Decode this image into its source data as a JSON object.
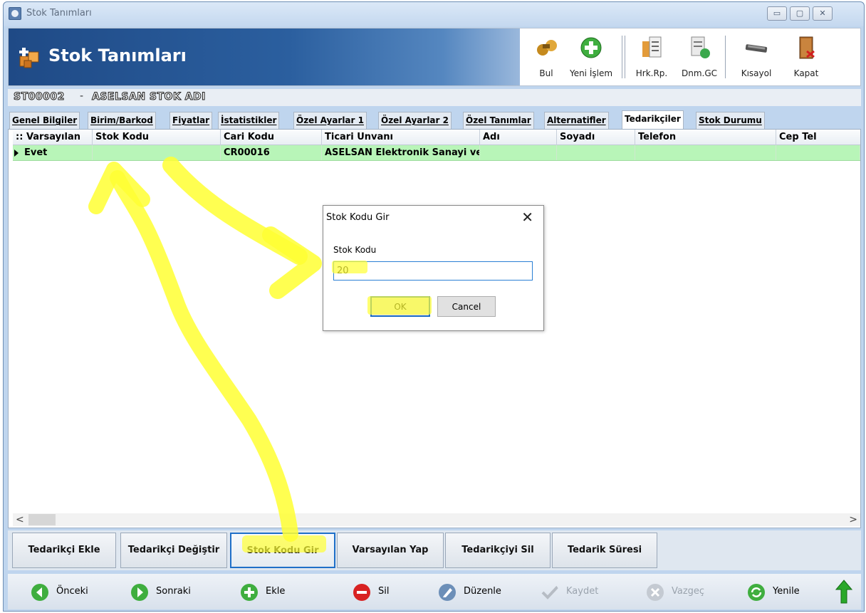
{
  "window": {
    "title": "Stok Tanımları",
    "controls": [
      "▭",
      "▢",
      "✕"
    ]
  },
  "header": {
    "title": "Stok Tanımları",
    "toolbar": [
      {
        "label": "Bul",
        "icon": "search-binoculars-icon"
      },
      {
        "label": "Yeni İşlem",
        "icon": "plus-circle-icon"
      },
      {
        "label": "Hrk.Rp.",
        "icon": "report-icon"
      },
      {
        "label": "Dnm.GC",
        "icon": "period-document-icon"
      },
      {
        "label": "Kısayol",
        "icon": "shortcut-icon"
      },
      {
        "label": "Kapat",
        "icon": "exit-door-icon"
      }
    ]
  },
  "record": {
    "code": "ST00002",
    "separator": "-",
    "name": "ASELSAN STOK ADI"
  },
  "tabs": [
    "Genel Bilgiler",
    "Birim/Barkod",
    "Fiyatlar",
    "İstatistikler",
    "Özel Ayarlar 1",
    "Özel Ayarlar 2",
    "Özel Tanımlar",
    "Alternatifler",
    "Tedarikçiler",
    "Stok Durumu"
  ],
  "active_tab": "Tedarikçiler",
  "grid": {
    "columns": [
      "Varsayılan",
      "Stok Kodu",
      "Cari Kodu",
      "Ticari Unvanı",
      "Adı",
      "Soyadı",
      "Telefon",
      "Cep Tel"
    ],
    "rows": [
      [
        "Evet",
        "",
        "CR00016",
        "ASELSAN Elektronik Sanayi ve",
        "",
        "",
        "",
        ""
      ]
    ],
    "row_color": "#b8f5b8"
  },
  "actions": [
    "Tedarikçi Ekle",
    "Tedarikçi Değiştir",
    "Stok Kodu Gir",
    "Varsayılan Yap",
    "Tedarikçiyi Sil",
    "Tedarik Süresi"
  ],
  "nav": [
    {
      "label": "Önceki",
      "icon": "back-arrow-icon",
      "enabled": true
    },
    {
      "label": "Sonraki",
      "icon": "forward-arrow-icon",
      "enabled": true
    },
    {
      "label": "Ekle",
      "icon": "add-icon",
      "enabled": true
    },
    {
      "label": "Sil",
      "icon": "delete-icon",
      "enabled": true
    },
    {
      "label": "Düzenle",
      "icon": "edit-icon",
      "enabled": true
    },
    {
      "label": "Kaydet",
      "icon": "save-check-icon",
      "enabled": false
    },
    {
      "label": "Vazgeç",
      "icon": "cancel-icon",
      "enabled": false
    },
    {
      "label": "Yenile",
      "icon": "refresh-icon",
      "enabled": true
    }
  ],
  "dialog": {
    "title": "Stok Kodu Gir",
    "label": "Stok Kodu",
    "value": "20",
    "ok": "OK",
    "cancel": "Cancel"
  },
  "colors": {
    "highlight": "#ffff33",
    "banner": "#1f4a86",
    "accent": "#1f6fc8"
  }
}
